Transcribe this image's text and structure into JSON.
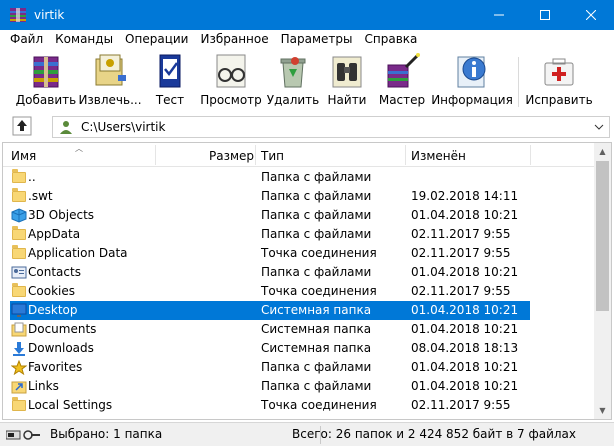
{
  "window": {
    "title": "virtik"
  },
  "menu": [
    "Файл",
    "Команды",
    "Операции",
    "Избранное",
    "Параметры",
    "Справка"
  ],
  "toolbar": {
    "add": "Добавить",
    "extract": "Извлечь...",
    "test": "Тест",
    "view": "Просмотр",
    "delete": "Удалить",
    "find": "Найти",
    "wizard": "Мастер",
    "info": "Информация",
    "repair": "Исправить"
  },
  "address": {
    "path": "C:\\Users\\virtik"
  },
  "columns": {
    "name": "Имя",
    "size": "Размер",
    "type": "Тип",
    "modified": "Изменён"
  },
  "files": [
    {
      "name": "..",
      "type": "Папка с файлами",
      "date": "",
      "icon": "folder-icon"
    },
    {
      "name": ".swt",
      "type": "Папка с файлами",
      "date": "19.02.2018 14:11",
      "icon": "folder-icon"
    },
    {
      "name": "3D Objects",
      "type": "Папка с файлами",
      "date": "01.04.2018 10:21",
      "icon": "3d-objects-icon"
    },
    {
      "name": "AppData",
      "type": "Папка с файлами",
      "date": "02.11.2017 9:55",
      "icon": "folder-icon"
    },
    {
      "name": "Application Data",
      "type": "Точка соединения",
      "date": "02.11.2017 9:55",
      "icon": "folder-icon"
    },
    {
      "name": "Contacts",
      "type": "Папка с файлами",
      "date": "01.04.2018 10:21",
      "icon": "contacts-icon"
    },
    {
      "name": "Cookies",
      "type": "Точка соединения",
      "date": "02.11.2017 9:55",
      "icon": "folder-icon"
    },
    {
      "name": "Desktop",
      "type": "Системная папка",
      "date": "01.04.2018 10:21",
      "icon": "desktop-icon",
      "selected": true
    },
    {
      "name": "Documents",
      "type": "Системная папка",
      "date": "01.04.2018 10:21",
      "icon": "documents-icon"
    },
    {
      "name": "Downloads",
      "type": "Системная папка",
      "date": "08.04.2018 18:13",
      "icon": "downloads-icon"
    },
    {
      "name": "Favorites",
      "type": "Папка с файлами",
      "date": "01.04.2018 10:21",
      "icon": "favorites-icon"
    },
    {
      "name": "Links",
      "type": "Папка с файлами",
      "date": "01.04.2018 10:21",
      "icon": "links-icon"
    },
    {
      "name": "Local Settings",
      "type": "Точка соединения",
      "date": "02.11.2017 9:55",
      "icon": "folder-icon"
    }
  ],
  "status": {
    "selected": "Выбрано: 1 папка",
    "total": "Всего: 26 папок и 2 424 852 байт в 7 файлах"
  },
  "colors": {
    "titlebar": "#0078d7",
    "selection": "#0078d7"
  }
}
